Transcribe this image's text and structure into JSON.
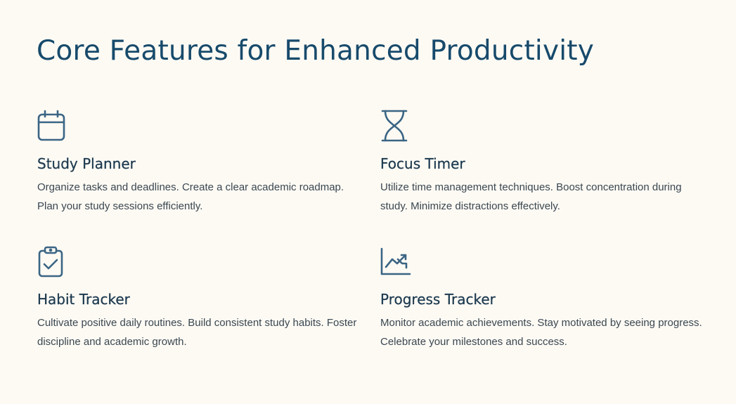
{
  "page": {
    "title": "Core Features for Enhanced Productivity"
  },
  "colors": {
    "background": "#fdfaf4",
    "title": "#174a6b",
    "icon": "#3b6584",
    "heading": "#1d3a4f",
    "body_text": "#3a4750"
  },
  "features": [
    {
      "icon": "calendar-icon",
      "title": "Study Planner",
      "description": "Organize tasks and deadlines. Create a clear academic roadmap. Plan your study sessions efficiently."
    },
    {
      "icon": "hourglass-icon",
      "title": "Focus Timer",
      "description": "Utilize time management techniques. Boost concentration during study. Minimize distractions effectively."
    },
    {
      "icon": "clipboard-check-icon",
      "title": "Habit Tracker",
      "description": "Cultivate positive daily routines. Build consistent study habits. Foster discipline and academic growth."
    },
    {
      "icon": "trending-up-chart-icon",
      "title": "Progress Tracker",
      "description": "Monitor academic achievements. Stay motivated by seeing progress. Celebrate your milestones and success."
    }
  ]
}
